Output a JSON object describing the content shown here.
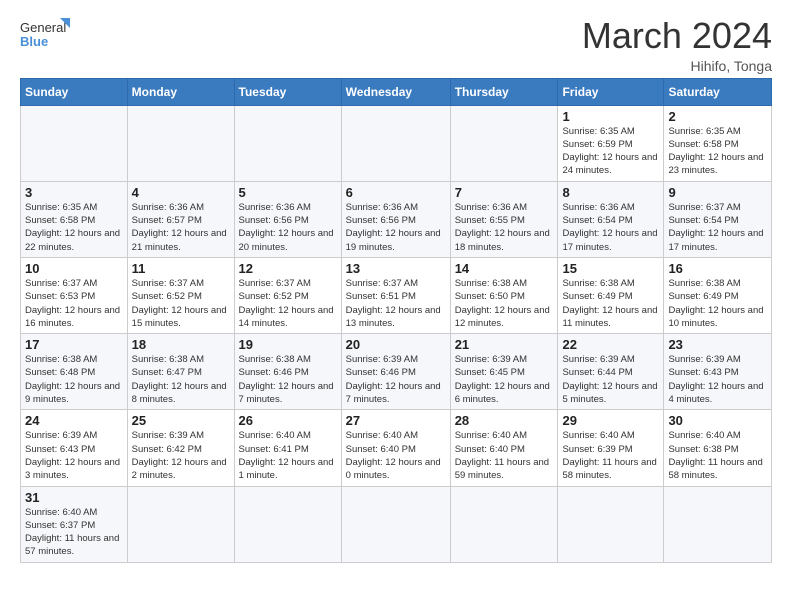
{
  "header": {
    "logo_general": "General",
    "logo_blue": "Blue",
    "month_title": "March 2024",
    "location": "Hihifo, Tonga"
  },
  "weekdays": [
    "Sunday",
    "Monday",
    "Tuesday",
    "Wednesday",
    "Thursday",
    "Friday",
    "Saturday"
  ],
  "weeks": [
    [
      {
        "day": "",
        "info": ""
      },
      {
        "day": "",
        "info": ""
      },
      {
        "day": "",
        "info": ""
      },
      {
        "day": "",
        "info": ""
      },
      {
        "day": "",
        "info": ""
      },
      {
        "day": "1",
        "info": "Sunrise: 6:35 AM\nSunset: 6:59 PM\nDaylight: 12 hours and 24 minutes."
      },
      {
        "day": "2",
        "info": "Sunrise: 6:35 AM\nSunset: 6:58 PM\nDaylight: 12 hours and 23 minutes."
      }
    ],
    [
      {
        "day": "3",
        "info": "Sunrise: 6:35 AM\nSunset: 6:58 PM\nDaylight: 12 hours and 22 minutes."
      },
      {
        "day": "4",
        "info": "Sunrise: 6:36 AM\nSunset: 6:57 PM\nDaylight: 12 hours and 21 minutes."
      },
      {
        "day": "5",
        "info": "Sunrise: 6:36 AM\nSunset: 6:56 PM\nDaylight: 12 hours and 20 minutes."
      },
      {
        "day": "6",
        "info": "Sunrise: 6:36 AM\nSunset: 6:56 PM\nDaylight: 12 hours and 19 minutes."
      },
      {
        "day": "7",
        "info": "Sunrise: 6:36 AM\nSunset: 6:55 PM\nDaylight: 12 hours and 18 minutes."
      },
      {
        "day": "8",
        "info": "Sunrise: 6:36 AM\nSunset: 6:54 PM\nDaylight: 12 hours and 17 minutes."
      },
      {
        "day": "9",
        "info": "Sunrise: 6:37 AM\nSunset: 6:54 PM\nDaylight: 12 hours and 17 minutes."
      }
    ],
    [
      {
        "day": "10",
        "info": "Sunrise: 6:37 AM\nSunset: 6:53 PM\nDaylight: 12 hours and 16 minutes."
      },
      {
        "day": "11",
        "info": "Sunrise: 6:37 AM\nSunset: 6:52 PM\nDaylight: 12 hours and 15 minutes."
      },
      {
        "day": "12",
        "info": "Sunrise: 6:37 AM\nSunset: 6:52 PM\nDaylight: 12 hours and 14 minutes."
      },
      {
        "day": "13",
        "info": "Sunrise: 6:37 AM\nSunset: 6:51 PM\nDaylight: 12 hours and 13 minutes."
      },
      {
        "day": "14",
        "info": "Sunrise: 6:38 AM\nSunset: 6:50 PM\nDaylight: 12 hours and 12 minutes."
      },
      {
        "day": "15",
        "info": "Sunrise: 6:38 AM\nSunset: 6:49 PM\nDaylight: 12 hours and 11 minutes."
      },
      {
        "day": "16",
        "info": "Sunrise: 6:38 AM\nSunset: 6:49 PM\nDaylight: 12 hours and 10 minutes."
      }
    ],
    [
      {
        "day": "17",
        "info": "Sunrise: 6:38 AM\nSunset: 6:48 PM\nDaylight: 12 hours and 9 minutes."
      },
      {
        "day": "18",
        "info": "Sunrise: 6:38 AM\nSunset: 6:47 PM\nDaylight: 12 hours and 8 minutes."
      },
      {
        "day": "19",
        "info": "Sunrise: 6:38 AM\nSunset: 6:46 PM\nDaylight: 12 hours and 7 minutes."
      },
      {
        "day": "20",
        "info": "Sunrise: 6:39 AM\nSunset: 6:46 PM\nDaylight: 12 hours and 7 minutes."
      },
      {
        "day": "21",
        "info": "Sunrise: 6:39 AM\nSunset: 6:45 PM\nDaylight: 12 hours and 6 minutes."
      },
      {
        "day": "22",
        "info": "Sunrise: 6:39 AM\nSunset: 6:44 PM\nDaylight: 12 hours and 5 minutes."
      },
      {
        "day": "23",
        "info": "Sunrise: 6:39 AM\nSunset: 6:43 PM\nDaylight: 12 hours and 4 minutes."
      }
    ],
    [
      {
        "day": "24",
        "info": "Sunrise: 6:39 AM\nSunset: 6:43 PM\nDaylight: 12 hours and 3 minutes."
      },
      {
        "day": "25",
        "info": "Sunrise: 6:39 AM\nSunset: 6:42 PM\nDaylight: 12 hours and 2 minutes."
      },
      {
        "day": "26",
        "info": "Sunrise: 6:40 AM\nSunset: 6:41 PM\nDaylight: 12 hours and 1 minute."
      },
      {
        "day": "27",
        "info": "Sunrise: 6:40 AM\nSunset: 6:40 PM\nDaylight: 12 hours and 0 minutes."
      },
      {
        "day": "28",
        "info": "Sunrise: 6:40 AM\nSunset: 6:40 PM\nDaylight: 11 hours and 59 minutes."
      },
      {
        "day": "29",
        "info": "Sunrise: 6:40 AM\nSunset: 6:39 PM\nDaylight: 11 hours and 58 minutes."
      },
      {
        "day": "30",
        "info": "Sunrise: 6:40 AM\nSunset: 6:38 PM\nDaylight: 11 hours and 58 minutes."
      }
    ],
    [
      {
        "day": "31",
        "info": "Sunrise: 6:40 AM\nSunset: 6:37 PM\nDaylight: 11 hours and 57 minutes."
      },
      {
        "day": "",
        "info": ""
      },
      {
        "day": "",
        "info": ""
      },
      {
        "day": "",
        "info": ""
      },
      {
        "day": "",
        "info": ""
      },
      {
        "day": "",
        "info": ""
      },
      {
        "day": "",
        "info": ""
      }
    ]
  ]
}
